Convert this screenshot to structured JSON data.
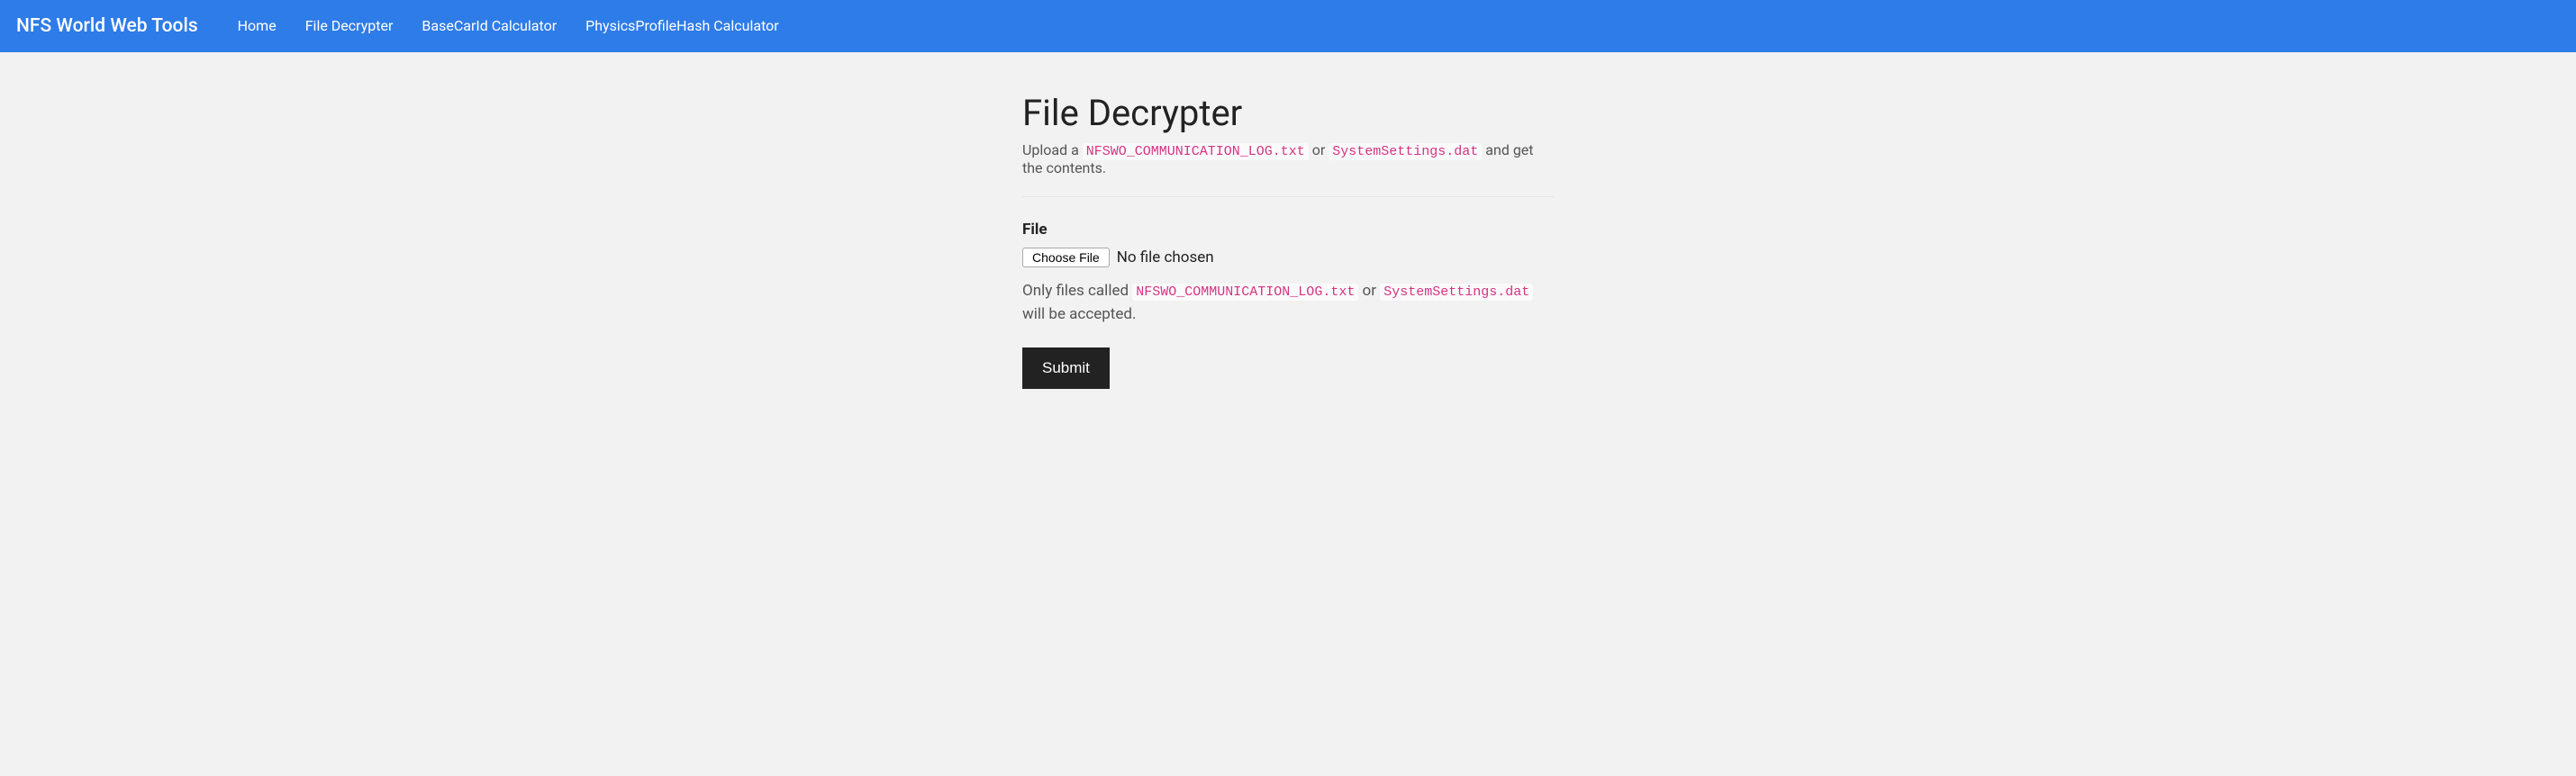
{
  "navbar": {
    "brand": "NFS World Web Tools",
    "items": [
      {
        "label": "Home"
      },
      {
        "label": "File Decrypter"
      },
      {
        "label": "BaseCarId Calculator"
      },
      {
        "label": "PhysicsProfileHash Calculator"
      }
    ]
  },
  "page": {
    "title": "File Decrypter",
    "desc_prefix": "Upload a ",
    "desc_code1": "NFSWO_COMMUNICATION_LOG.txt",
    "desc_or": " or ",
    "desc_code2": "SystemSettings.dat",
    "desc_suffix": " and get the contents."
  },
  "form": {
    "file_label": "File",
    "choose_label": "Choose File",
    "file_status": "No file chosen",
    "help_prefix": "Only files called ",
    "help_code1": "NFSWO_COMMUNICATION_LOG.txt",
    "help_or": " or ",
    "help_code2": "SystemSettings.dat",
    "help_suffix": " will be accepted.",
    "submit_label": "Submit"
  }
}
